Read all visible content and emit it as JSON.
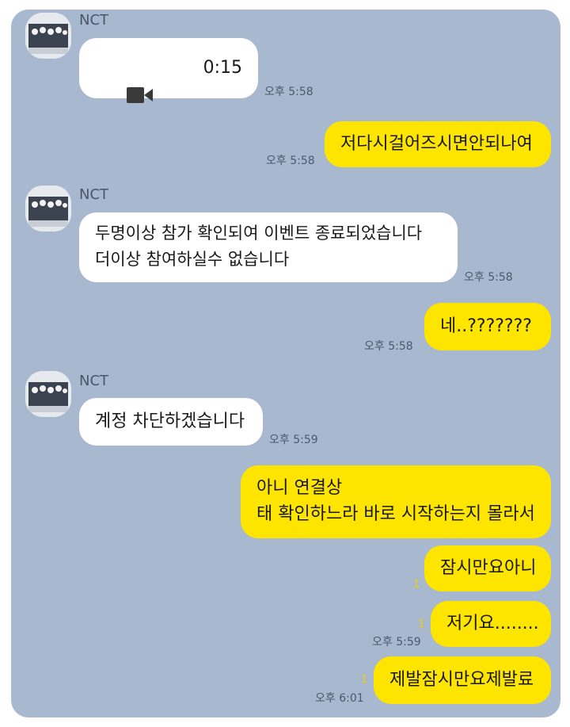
{
  "sender_name": "NCT",
  "video_message": {
    "icon": "video-camera-icon",
    "duration": "0:15",
    "time": "오후 5:58"
  },
  "messages": [
    {
      "text": "저다시걸어즈시면안되나여",
      "time": "오후 5:58"
    },
    {
      "text": "두명이상 참가 확인되여 이벤트 종료되었습니다\n더이상 참여하실수 없습니다",
      "time": "오후 5:58"
    },
    {
      "text": "네..???????",
      "time": "오후 5:58"
    },
    {
      "text": "계정 차단하겠습니다",
      "time": "오후 5:59"
    },
    {
      "text": "아니 연결상\n태 확인하느라 바로 시작하는지 몰라서"
    },
    {
      "text": "잠시만요아니",
      "unread": "1"
    },
    {
      "text": "저기요........",
      "unread": "1",
      "time": "오후 5:59"
    },
    {
      "text": "제발잠시만요제발료",
      "unread": "1",
      "time": "오후 6:01"
    }
  ],
  "colors": {
    "chat_background": "#a8b9cf",
    "incoming_bubble": "#ffffff",
    "outgoing_bubble": "#fee500"
  }
}
